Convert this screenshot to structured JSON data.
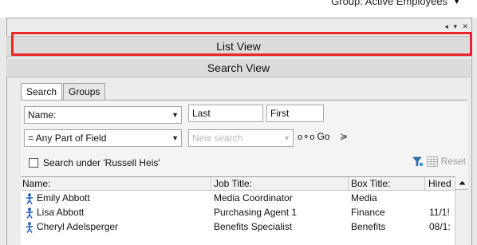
{
  "header": {
    "group_label": "Group: Active Employees"
  },
  "panel": {
    "controls": "◂ ▾ ✕"
  },
  "views": {
    "list_view": "List View",
    "search_view": "Search View"
  },
  "tabs": [
    {
      "label": "Search",
      "active": true
    },
    {
      "label": "Groups",
      "active": false
    }
  ],
  "search": {
    "field_select": "Name:",
    "last_placeholder": "Last",
    "first_placeholder": "First",
    "match_select": "= Any Part of Field",
    "new_search_placeholder": "New search",
    "go_label": "Go",
    "under_label": "Search under 'Russell Heis'",
    "reset_label": "Reset"
  },
  "grid": {
    "columns": [
      "Name:",
      "Job Title:",
      "Box Title:",
      "Hired"
    ],
    "rows": [
      {
        "name": "Emily  Abbott",
        "job": "Media Coordinator",
        "box": "Media",
        "hired": ""
      },
      {
        "name": "Lisa  Abbott",
        "job": "Purchasing Agent 1",
        "box": "Finance",
        "hired": "11/1!"
      },
      {
        "name": "Cheryl  Adelsperger",
        "job": "Benefits Specialist",
        "box": "Benefits",
        "hired": "08/1:"
      }
    ]
  },
  "colors": {
    "highlight": "#e8282a",
    "person_icon": "#1f56c8"
  }
}
